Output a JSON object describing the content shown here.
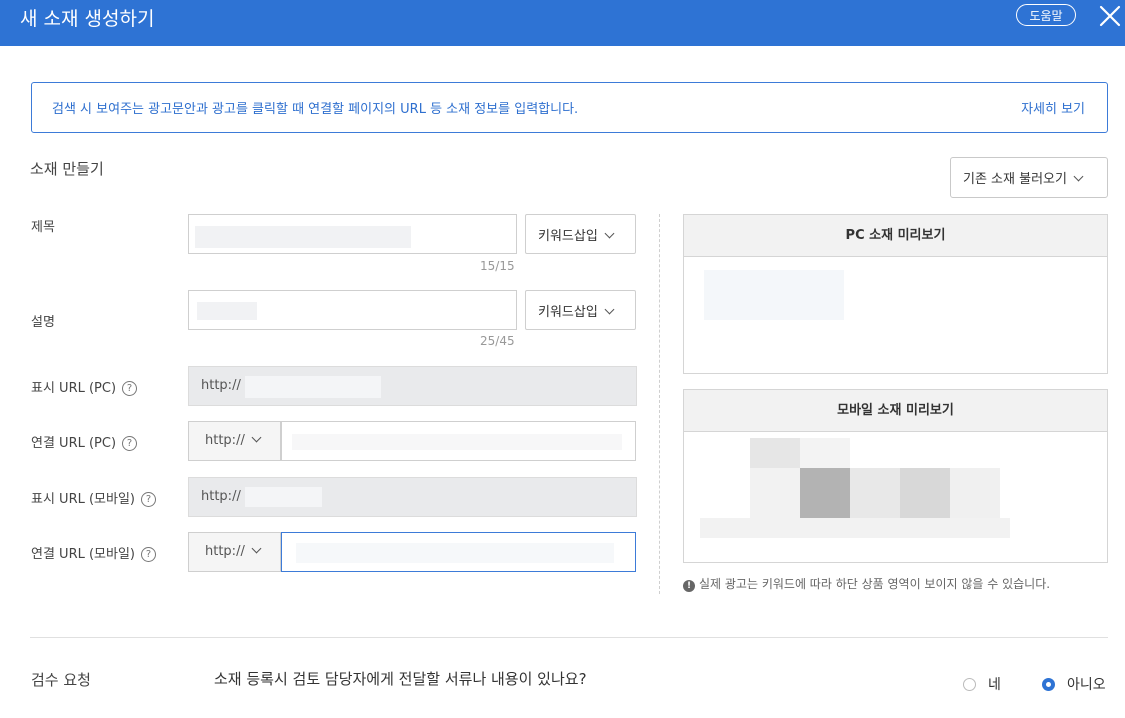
{
  "header": {
    "title": "새 소재 생성하기",
    "help_label": "도움말"
  },
  "notice": {
    "text": "검색 시 보여주는 광고문안과 광고를 클릭할 때 연결할 페이지의 URL 등 소재 정보를 입력합니다.",
    "link": "자세히 보기"
  },
  "form": {
    "section_title": "소재 만들기",
    "load_button": "기존 소재 불러오기",
    "title_label": "제목",
    "title_counter": "15/15",
    "desc_label": "설명",
    "desc_counter": "25/45",
    "keyword_insert": "키워드삽입",
    "display_url_pc_label": "표시 URL (PC)",
    "display_url_pc_prefix": "http://",
    "link_url_pc_label": "연결 URL (PC)",
    "link_url_pc_protocol": "http://",
    "display_url_mobile_label": "표시 URL (모바일)",
    "display_url_mobile_prefix": "http://",
    "link_url_mobile_label": "연결 URL (모바일)",
    "link_url_mobile_protocol": "http://",
    "help_glyph": "?"
  },
  "preview": {
    "pc_title": "PC 소재 미리보기",
    "mobile_title": "모바일 소재 미리보기",
    "note": "실제 광고는 키워드에 따라 하단 상품 영역이 보이지 않을 수 있습니다."
  },
  "review": {
    "title": "검수 요청",
    "question": "소재 등록시 검토 담당자에게 전달할 서류나 내용이 있나요?",
    "options": [
      "네",
      "아니오"
    ],
    "selected": "아니오"
  },
  "colors": {
    "header": "#2e73d4",
    "accent": "#3d7bd8"
  }
}
